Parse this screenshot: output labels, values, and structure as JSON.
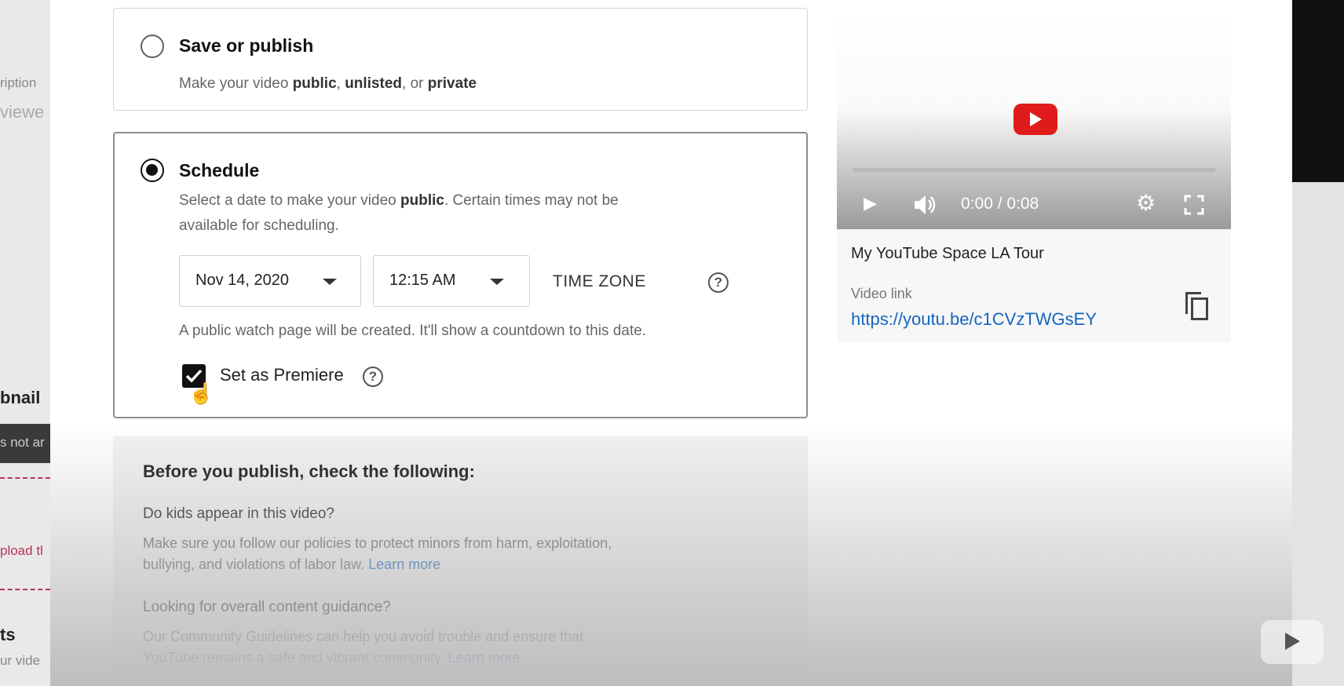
{
  "background": {
    "left_fragments": [
      "ription",
      "viewe",
      "bnail",
      "s not ar",
      "pload tl",
      "ts",
      "ur vide"
    ]
  },
  "visibility": {
    "save_or_publish": {
      "title": "Save or publish",
      "subtitle_prefix": "Make your video ",
      "subtitle_public": "public",
      "subtitle_sep1": ", ",
      "subtitle_unlisted": "unlisted",
      "subtitle_sep2": ", or ",
      "subtitle_private": "private"
    },
    "schedule": {
      "title": "Schedule",
      "desc_prefix": "Select a date to make your video ",
      "desc_public": "public",
      "desc_suffix": ". Certain times may not be",
      "desc_line2": "available for scheduling.",
      "date": "Nov 14, 2020",
      "time": "12:15 AM",
      "timezone_label": "TIME ZONE",
      "note": "A public watch page will be created. It'll show a countdown to this date.",
      "premiere_label": "Set as Premiere",
      "premiere_checked": true,
      "selected": true
    }
  },
  "checklist": {
    "heading": "Before you publish, check the following:",
    "q1": "Do kids appear in this video?",
    "p1_line1": "Make sure you follow our policies to protect minors from harm, exploitation,",
    "p1_line2": "bullying, and violations of labor law. ",
    "q2": "Looking for overall content guidance?",
    "p2_line1": "Our Community Guidelines can help you avoid trouble and ensure that",
    "p2_line2": "YouTube remains a safe and vibrant community. ",
    "learn_more": "Learn more"
  },
  "video": {
    "time": "0:00 / 0:08",
    "title": "My YouTube Space LA Tour",
    "link_label": "Video link",
    "link": "https://youtu.be/c1CVzTWGsEY"
  },
  "colors": {
    "link": "#1565c0",
    "youtube_red": "#e01b1b"
  }
}
